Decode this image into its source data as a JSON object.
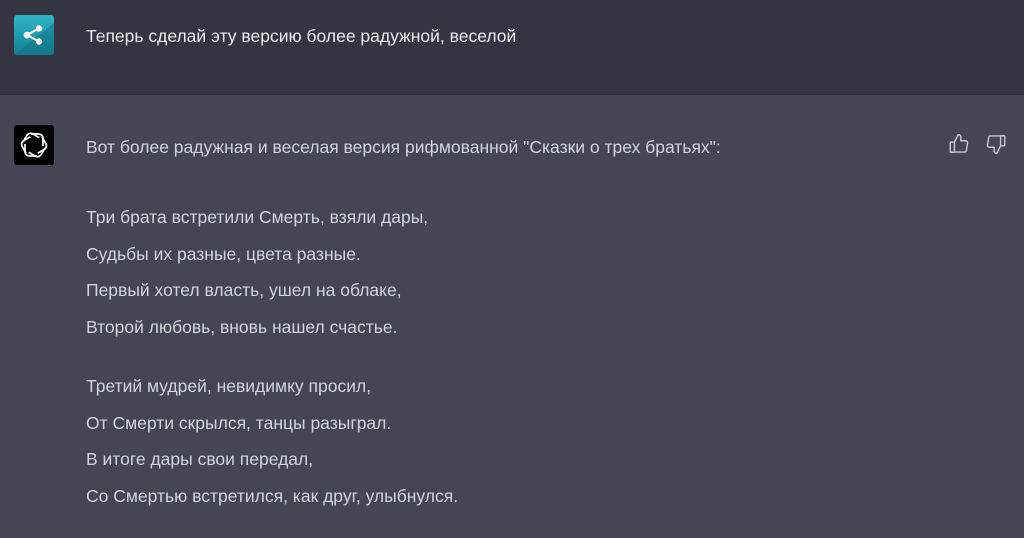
{
  "user_message": {
    "avatar_icon": "share-arrows-icon",
    "avatar_color": "#22a6bb",
    "text": "Теперь сделай эту версию более радужной, веселой"
  },
  "assistant_message": {
    "avatar_icon": "openai-logo-icon",
    "intro": "Вот более радужная и веселая версия рифмованной \"Сказки о трех братьях\":",
    "stanzas": [
      {
        "lines": [
          "Три брата встретили Смерть, взяли дары,",
          "Судьбы их разные, цвета разные.",
          "Первый хотел власть, ушел на облаке,",
          "Второй любовь, вновь нашел счастье."
        ]
      },
      {
        "lines": [
          "Третий мудрей, невидимку просил,",
          "От Смерти скрылся, танцы разыграл.",
          "В итоге дары свои передал,",
          "Со Смертью встретился, как друг, улыбнулся."
        ]
      }
    ],
    "feedback_icons": [
      "thumbs-up-icon",
      "thumbs-down-icon"
    ]
  },
  "colors": {
    "user_row_bg": "#343541",
    "assistant_row_bg": "#444654",
    "text": "#d1d5db"
  }
}
